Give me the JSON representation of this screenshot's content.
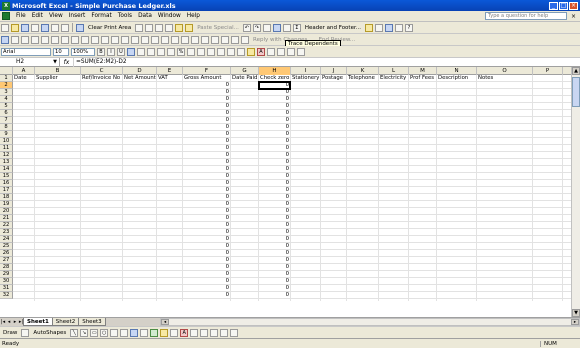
{
  "window": {
    "title": "Microsoft Excel - Simple Purchase Ledger.xls",
    "icon": "excel-icon"
  },
  "menu": [
    "File",
    "Edit",
    "View",
    "Insert",
    "Format",
    "Tools",
    "Data",
    "Window",
    "Help"
  ],
  "help_box": {
    "placeholder": "Type a question for help"
  },
  "toolbar1": {
    "clear_print_area": "Clear Print Area",
    "paste_special": "Paste Special...",
    "header_footer": "Header and Footer...",
    "tooltip": "Trace Dependents"
  },
  "toolbar2": {
    "reply_with_changes": "Reply with Changes...",
    "end_review": "End Review..."
  },
  "format_bar": {
    "font": "Arial",
    "size": "10",
    "zoom": "100%"
  },
  "name_box": "H2",
  "formula": "=SUM(E2:M2)-D2",
  "columns": [
    "A",
    "B",
    "C",
    "D",
    "E",
    "F",
    "G",
    "H",
    "I",
    "J",
    "K",
    "L",
    "M",
    "N",
    "O",
    "P",
    "Q"
  ],
  "headers": [
    "Date",
    "Supplier",
    "Ref/Invoice No",
    "Net Amount",
    "VAT",
    "Gross Amount",
    "Date Paid",
    "Check zero",
    "Stationery",
    "Postage",
    "Telephone",
    "Electricity",
    "Prof Fees",
    "Description",
    "Notes",
    "",
    ""
  ],
  "row_count": 32,
  "zero_value": "0",
  "sheets": [
    "Sheet1",
    "Sheet2",
    "Sheet3"
  ],
  "drawing": {
    "draw": "Draw",
    "autoshapes": "AutoShapes"
  },
  "status": {
    "left": "Ready",
    "right": "NUM"
  }
}
